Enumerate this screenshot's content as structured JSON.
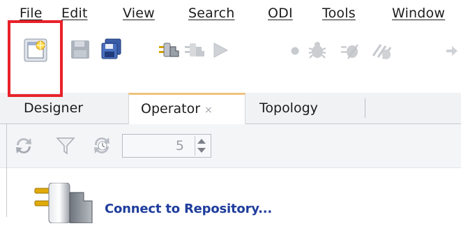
{
  "menu": {
    "items": [
      {
        "label": "File"
      },
      {
        "label": "Edit"
      },
      {
        "label": "View"
      },
      {
        "label": "Search"
      },
      {
        "label": "ODI"
      },
      {
        "label": "Tools"
      },
      {
        "label": "Window"
      }
    ]
  },
  "toolbar": {
    "buttons": [
      {
        "icon": "new-icon"
      },
      {
        "icon": "save-icon"
      },
      {
        "icon": "save-all-icon"
      },
      {
        "icon": "connect-icon"
      },
      {
        "icon": "disconnect-icon"
      },
      {
        "icon": "run-icon"
      },
      {
        "icon": "breakpoint-icon"
      },
      {
        "icon": "debug-icon"
      },
      {
        "icon": "debug-step-icon"
      },
      {
        "icon": "debug-skip-icon"
      },
      {
        "icon": "navigate-icon"
      }
    ]
  },
  "tabs": [
    {
      "label": "Designer",
      "active": false
    },
    {
      "label": "Operator",
      "active": true,
      "close": "×"
    },
    {
      "label": "Topology",
      "active": false
    }
  ],
  "operator": {
    "spinner_value": "5",
    "connect_label": "Connect to Repository...",
    "icons": [
      "refresh-icon",
      "filter-icon",
      "auto-refresh-icon"
    ]
  },
  "colors": {
    "highlight": "#e8212a",
    "link": "#1f3d9c",
    "active_tab_accent": "#f1c27d"
  }
}
